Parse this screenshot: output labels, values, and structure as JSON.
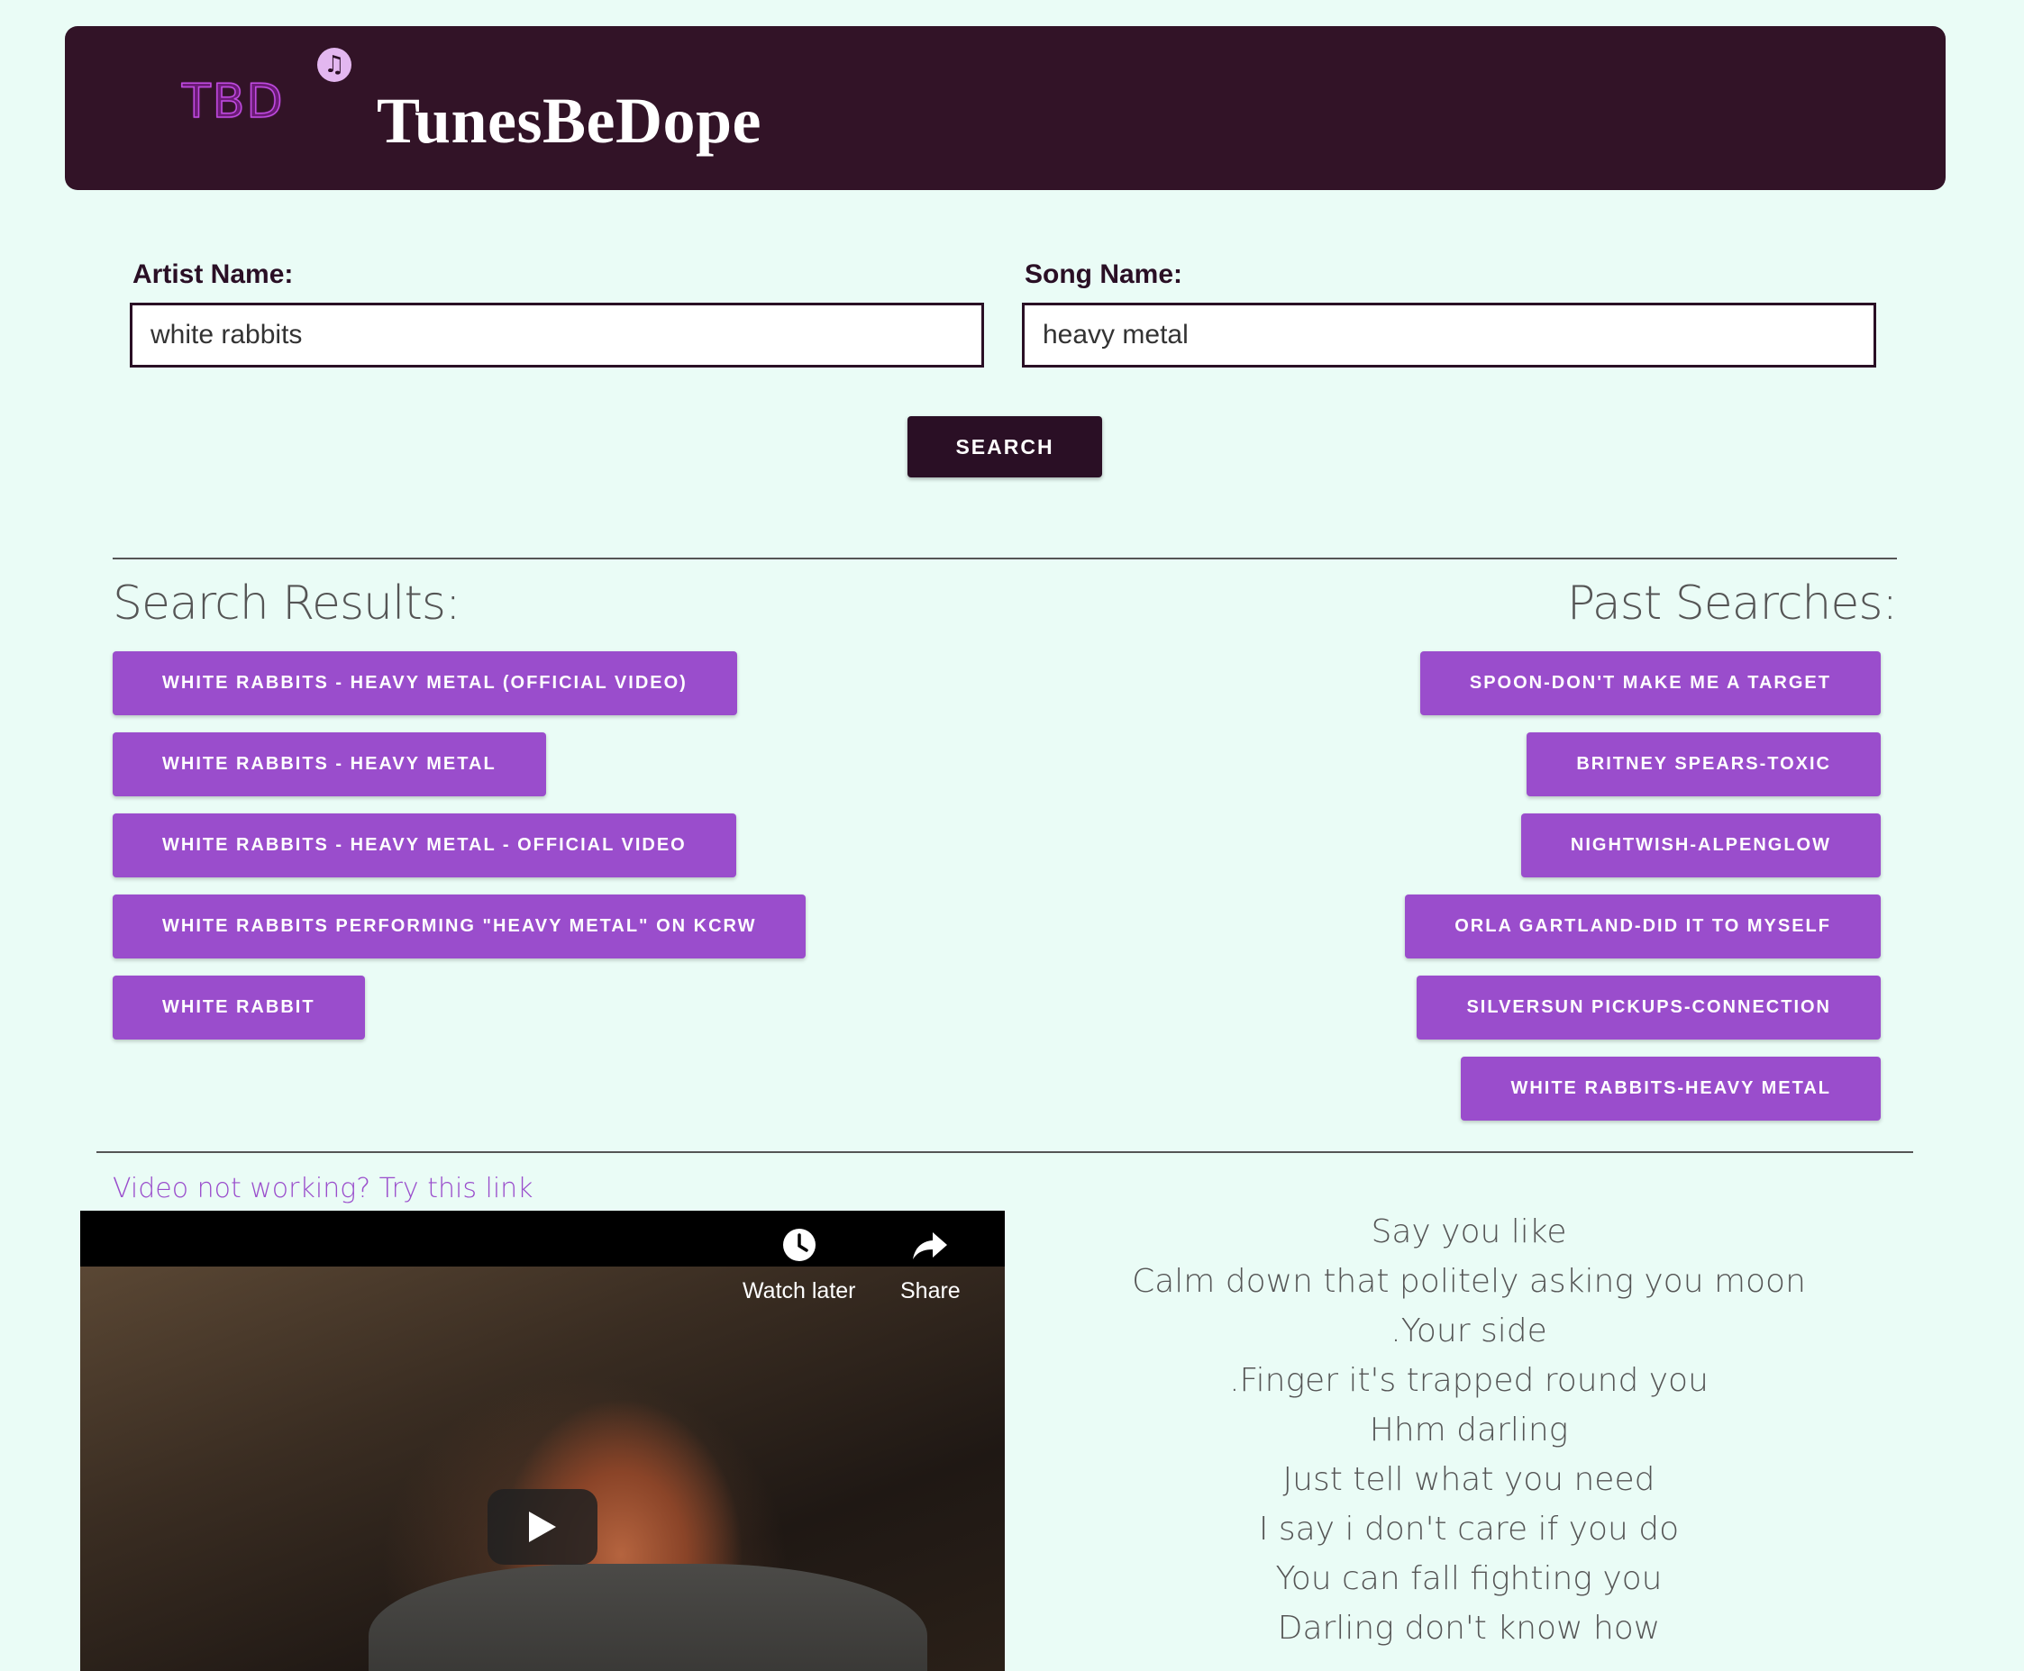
{
  "header": {
    "logo_text": "TBD",
    "logo_icon": "music-note-icon",
    "title": "TunesBeDope"
  },
  "search": {
    "artist_label": "Artist Name:",
    "artist_value": "white rabbits",
    "song_label": "Song Name:",
    "song_value": "heavy metal",
    "button_label": "SEARCH"
  },
  "results": {
    "heading": "Search Results:",
    "items": [
      "White Rabbits - Heavy Metal (Official Video)",
      "White Rabbits - Heavy Metal",
      "White Rabbits - Heavy Metal - Official Video",
      "White Rabbits performing \"Heavy Metal\" on KCRW",
      "White Rabbit"
    ]
  },
  "past": {
    "heading": "Past Searches:",
    "items": [
      "spoon-don't make me a target",
      "britney spears-toxic",
      "nightwish-alpenglow",
      "orla gartland-did it to myself",
      "silversun pickups-connection",
      "white rabbits-heavy metal"
    ]
  },
  "video": {
    "link_text": "Video not working? Try this link",
    "watch_later_label": "Watch later",
    "watch_later_icon": "clock-icon",
    "share_label": "Share",
    "share_icon": "share-arrow-icon",
    "play_icon": "play-icon"
  },
  "lyrics": [
    "Say you like",
    "Calm down that politely asking you moon",
    ".Your side",
    ".Finger it's trapped round you",
    "Hhm darling",
    "Just tell what you need",
    "I say i don't care if you do",
    "You can fall fighting you",
    "Darling don't know how"
  ],
  "colors": {
    "background": "#eafcf6",
    "header": "#321327",
    "accent_purple": "#9a4dcc",
    "dark_button": "#2a0f25"
  }
}
